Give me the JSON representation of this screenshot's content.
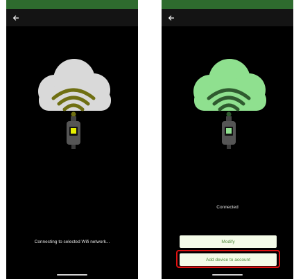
{
  "screens": {
    "connecting": {
      "back_icon": "arrow-left-icon",
      "status_text": "Connecting to selected Wifi network..."
    },
    "connected": {
      "back_icon": "arrow-left-icon",
      "status_text": "Connected",
      "buttons": {
        "modify_label": "Modify",
        "add_device_label": "Add device to account"
      }
    }
  },
  "colors": {
    "status_bar": "#2e6b2e",
    "cloud_connecting": "#d9d9d9",
    "wifi_connecting": "#6f6f12",
    "cloud_connected": "#8fe08f",
    "wifi_connected": "#2f5a2f",
    "button_text": "#4f8b3a",
    "highlight": "#e01212"
  }
}
